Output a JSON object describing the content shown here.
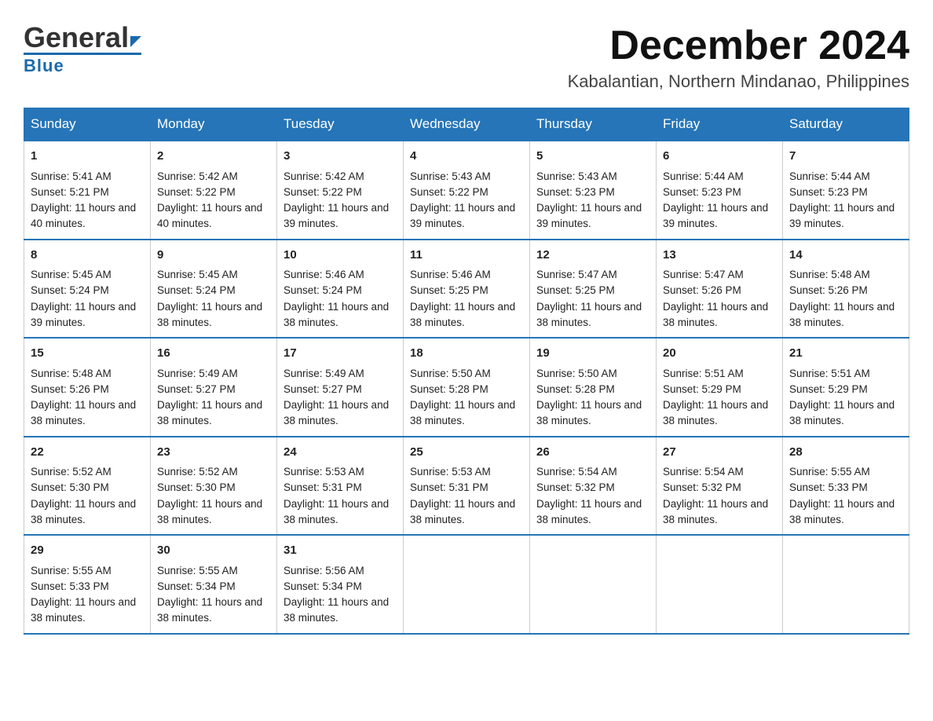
{
  "header": {
    "logo_general": "General",
    "logo_blue": "Blue",
    "month_title": "December 2024",
    "location": "Kabalantian, Northern Mindanao, Philippines"
  },
  "days_of_week": [
    "Sunday",
    "Monday",
    "Tuesday",
    "Wednesday",
    "Thursday",
    "Friday",
    "Saturday"
  ],
  "weeks": [
    [
      {
        "day": "1",
        "sunrise": "5:41 AM",
        "sunset": "5:21 PM",
        "daylight": "11 hours and 40 minutes."
      },
      {
        "day": "2",
        "sunrise": "5:42 AM",
        "sunset": "5:22 PM",
        "daylight": "11 hours and 40 minutes."
      },
      {
        "day": "3",
        "sunrise": "5:42 AM",
        "sunset": "5:22 PM",
        "daylight": "11 hours and 39 minutes."
      },
      {
        "day": "4",
        "sunrise": "5:43 AM",
        "sunset": "5:22 PM",
        "daylight": "11 hours and 39 minutes."
      },
      {
        "day": "5",
        "sunrise": "5:43 AM",
        "sunset": "5:23 PM",
        "daylight": "11 hours and 39 minutes."
      },
      {
        "day": "6",
        "sunrise": "5:44 AM",
        "sunset": "5:23 PM",
        "daylight": "11 hours and 39 minutes."
      },
      {
        "day": "7",
        "sunrise": "5:44 AM",
        "sunset": "5:23 PM",
        "daylight": "11 hours and 39 minutes."
      }
    ],
    [
      {
        "day": "8",
        "sunrise": "5:45 AM",
        "sunset": "5:24 PM",
        "daylight": "11 hours and 39 minutes."
      },
      {
        "day": "9",
        "sunrise": "5:45 AM",
        "sunset": "5:24 PM",
        "daylight": "11 hours and 38 minutes."
      },
      {
        "day": "10",
        "sunrise": "5:46 AM",
        "sunset": "5:24 PM",
        "daylight": "11 hours and 38 minutes."
      },
      {
        "day": "11",
        "sunrise": "5:46 AM",
        "sunset": "5:25 PM",
        "daylight": "11 hours and 38 minutes."
      },
      {
        "day": "12",
        "sunrise": "5:47 AM",
        "sunset": "5:25 PM",
        "daylight": "11 hours and 38 minutes."
      },
      {
        "day": "13",
        "sunrise": "5:47 AM",
        "sunset": "5:26 PM",
        "daylight": "11 hours and 38 minutes."
      },
      {
        "day": "14",
        "sunrise": "5:48 AM",
        "sunset": "5:26 PM",
        "daylight": "11 hours and 38 minutes."
      }
    ],
    [
      {
        "day": "15",
        "sunrise": "5:48 AM",
        "sunset": "5:26 PM",
        "daylight": "11 hours and 38 minutes."
      },
      {
        "day": "16",
        "sunrise": "5:49 AM",
        "sunset": "5:27 PM",
        "daylight": "11 hours and 38 minutes."
      },
      {
        "day": "17",
        "sunrise": "5:49 AM",
        "sunset": "5:27 PM",
        "daylight": "11 hours and 38 minutes."
      },
      {
        "day": "18",
        "sunrise": "5:50 AM",
        "sunset": "5:28 PM",
        "daylight": "11 hours and 38 minutes."
      },
      {
        "day": "19",
        "sunrise": "5:50 AM",
        "sunset": "5:28 PM",
        "daylight": "11 hours and 38 minutes."
      },
      {
        "day": "20",
        "sunrise": "5:51 AM",
        "sunset": "5:29 PM",
        "daylight": "11 hours and 38 minutes."
      },
      {
        "day": "21",
        "sunrise": "5:51 AM",
        "sunset": "5:29 PM",
        "daylight": "11 hours and 38 minutes."
      }
    ],
    [
      {
        "day": "22",
        "sunrise": "5:52 AM",
        "sunset": "5:30 PM",
        "daylight": "11 hours and 38 minutes."
      },
      {
        "day": "23",
        "sunrise": "5:52 AM",
        "sunset": "5:30 PM",
        "daylight": "11 hours and 38 minutes."
      },
      {
        "day": "24",
        "sunrise": "5:53 AM",
        "sunset": "5:31 PM",
        "daylight": "11 hours and 38 minutes."
      },
      {
        "day": "25",
        "sunrise": "5:53 AM",
        "sunset": "5:31 PM",
        "daylight": "11 hours and 38 minutes."
      },
      {
        "day": "26",
        "sunrise": "5:54 AM",
        "sunset": "5:32 PM",
        "daylight": "11 hours and 38 minutes."
      },
      {
        "day": "27",
        "sunrise": "5:54 AM",
        "sunset": "5:32 PM",
        "daylight": "11 hours and 38 minutes."
      },
      {
        "day": "28",
        "sunrise": "5:55 AM",
        "sunset": "5:33 PM",
        "daylight": "11 hours and 38 minutes."
      }
    ],
    [
      {
        "day": "29",
        "sunrise": "5:55 AM",
        "sunset": "5:33 PM",
        "daylight": "11 hours and 38 minutes."
      },
      {
        "day": "30",
        "sunrise": "5:55 AM",
        "sunset": "5:34 PM",
        "daylight": "11 hours and 38 minutes."
      },
      {
        "day": "31",
        "sunrise": "5:56 AM",
        "sunset": "5:34 PM",
        "daylight": "11 hours and 38 minutes."
      },
      null,
      null,
      null,
      null
    ]
  ],
  "labels": {
    "sunrise": "Sunrise:",
    "sunset": "Sunset:",
    "daylight": "Daylight:"
  }
}
